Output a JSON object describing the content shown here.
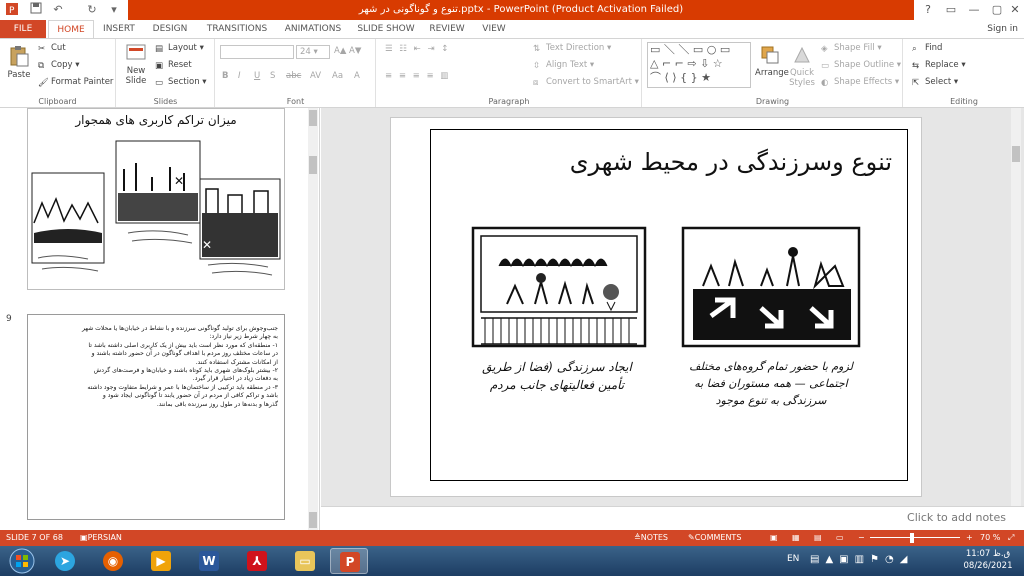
{
  "window": {
    "title": "تنوع و گوناگونی در شهر.pptx - PowerPoint (Product Activation Failed)",
    "controls": [
      "?",
      "▭",
      "—",
      "▢",
      "✕"
    ]
  },
  "tabs": [
    "FILE",
    "HOME",
    "INSERT",
    "DESIGN",
    "TRANSITIONS",
    "ANIMATIONS",
    "SLIDE SHOW",
    "REVIEW",
    "VIEW"
  ],
  "active_tab": "HOME",
  "signin": "Sign in",
  "ribbon": {
    "clipboard": {
      "label": "Clipboard",
      "paste": "Paste",
      "cut": "Cut",
      "copy": "Copy",
      "format_painter": "Format Painter"
    },
    "slides": {
      "label": "Slides",
      "new_slide": "New",
      "new_slide_2": "Slide",
      "layout": "Layout",
      "reset": "Reset",
      "section": "Section"
    },
    "font": {
      "label": "Font",
      "size": "24",
      "buttons": [
        "B",
        "I",
        "U",
        "S",
        "abc",
        "AV",
        "Aa",
        "A"
      ]
    },
    "paragraph": {
      "label": "Paragraph",
      "text_direction": "Text Direction",
      "align_text": "Align Text",
      "smartart": "Convert to SmartArt"
    },
    "drawing": {
      "label": "Drawing",
      "arrange": "Arrange",
      "quick_styles": "Quick",
      "quick_styles_2": "Styles",
      "shape_fill": "Shape Fill",
      "shape_outline": "Shape Outline",
      "shape_effects": "Shape Effects"
    },
    "editing": {
      "label": "Editing",
      "find": "Find",
      "replace": "Replace",
      "select": "Select"
    }
  },
  "thumbnails": [
    {
      "number": "",
      "title": "میزان تراکم کاربری های همجوار"
    },
    {
      "number": "9",
      "lines": [
        "جنب‌وجوش برای تولید گوناگونی سرزنده و با نشاط در خیابان‌ها یا محلات شهر",
        "به چهار شرط زیر نیاز دارد:",
        "۱- منطقه‌ای که مورد نظر است باید بیش از یک کاربری اصلی داشته باشد تا",
        "در ساعات مختلف روز مردم با اهداف گوناگون در آن حضور داشته باشند و",
        "از امکانات مشترک استفاده کنند.",
        "۲- بیشتر بلوک‌های شهری باید کوتاه باشند و خیابان‌ها و فرصت‌های گردش",
        "به دفعات زیاد در اختیار قرار گیرد.",
        "۳- در منطقه باید ترکیبی از ساختمان‌ها با عمر و شرایط متفاوت وجود داشته",
        "باشد و تراکم کافی از مردم در آن حضور یابند تا گوناگونی ایجاد شود و",
        "گذرها و بدنه‌ها در طول روز سرزنده باقی بمانند."
      ]
    }
  ],
  "slide": {
    "title": "تنوع وسرزندگی در محیط شهری",
    "caption_left": "ایجاد سرزندگی (فضا از طریق تأمین فعالیتهای جانب مردم",
    "caption_right": "لزوم با حضور تمام گروه‌های مختلف اجتماعی — همه مستوران فضا به سرزندگی به تنوع موجود"
  },
  "notes_placeholder": "Click to add notes",
  "status": {
    "slide": "SLIDE 7 OF 68",
    "language": "PERSIAN",
    "notes": "NOTES",
    "comments": "COMMENTS",
    "zoom": "70 %"
  },
  "taskbar": {
    "lang": "EN",
    "time": "11:07 ق.ظ",
    "date": "08/26/2021"
  },
  "colors": {
    "accent": "#d24726",
    "titlebar": "#d83b01",
    "taskbar": "#1d3d63"
  }
}
